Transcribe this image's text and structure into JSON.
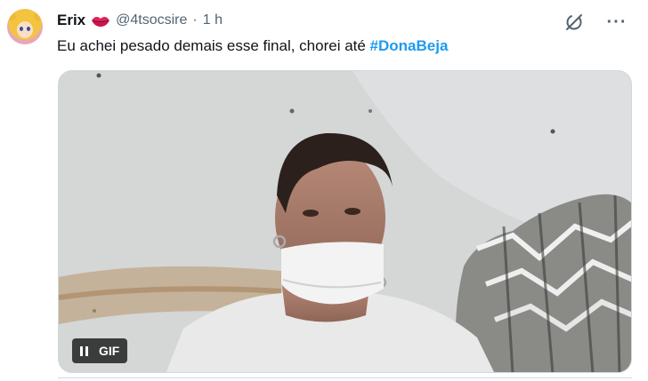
{
  "author": {
    "name": "Erix",
    "handle": "@4tsocsire",
    "separator": "·",
    "time": "1 h",
    "emoji_icon": "lips-kiss-icon",
    "avatar_icon": "anime-avatar"
  },
  "tweet": {
    "text": "Eu achei pesado demais esse final, chorei até ",
    "hashtag": "#DonaBeja"
  },
  "media": {
    "gif_label": "GIF",
    "pause_icon": "pause-icon"
  },
  "actions": {
    "grok_icon": "grok-icon",
    "more_label": "···"
  },
  "colors": {
    "accent": "#1d9bf0",
    "secondary_text": "#536471",
    "text": "#0f1419",
    "lips": "#e0245e"
  }
}
